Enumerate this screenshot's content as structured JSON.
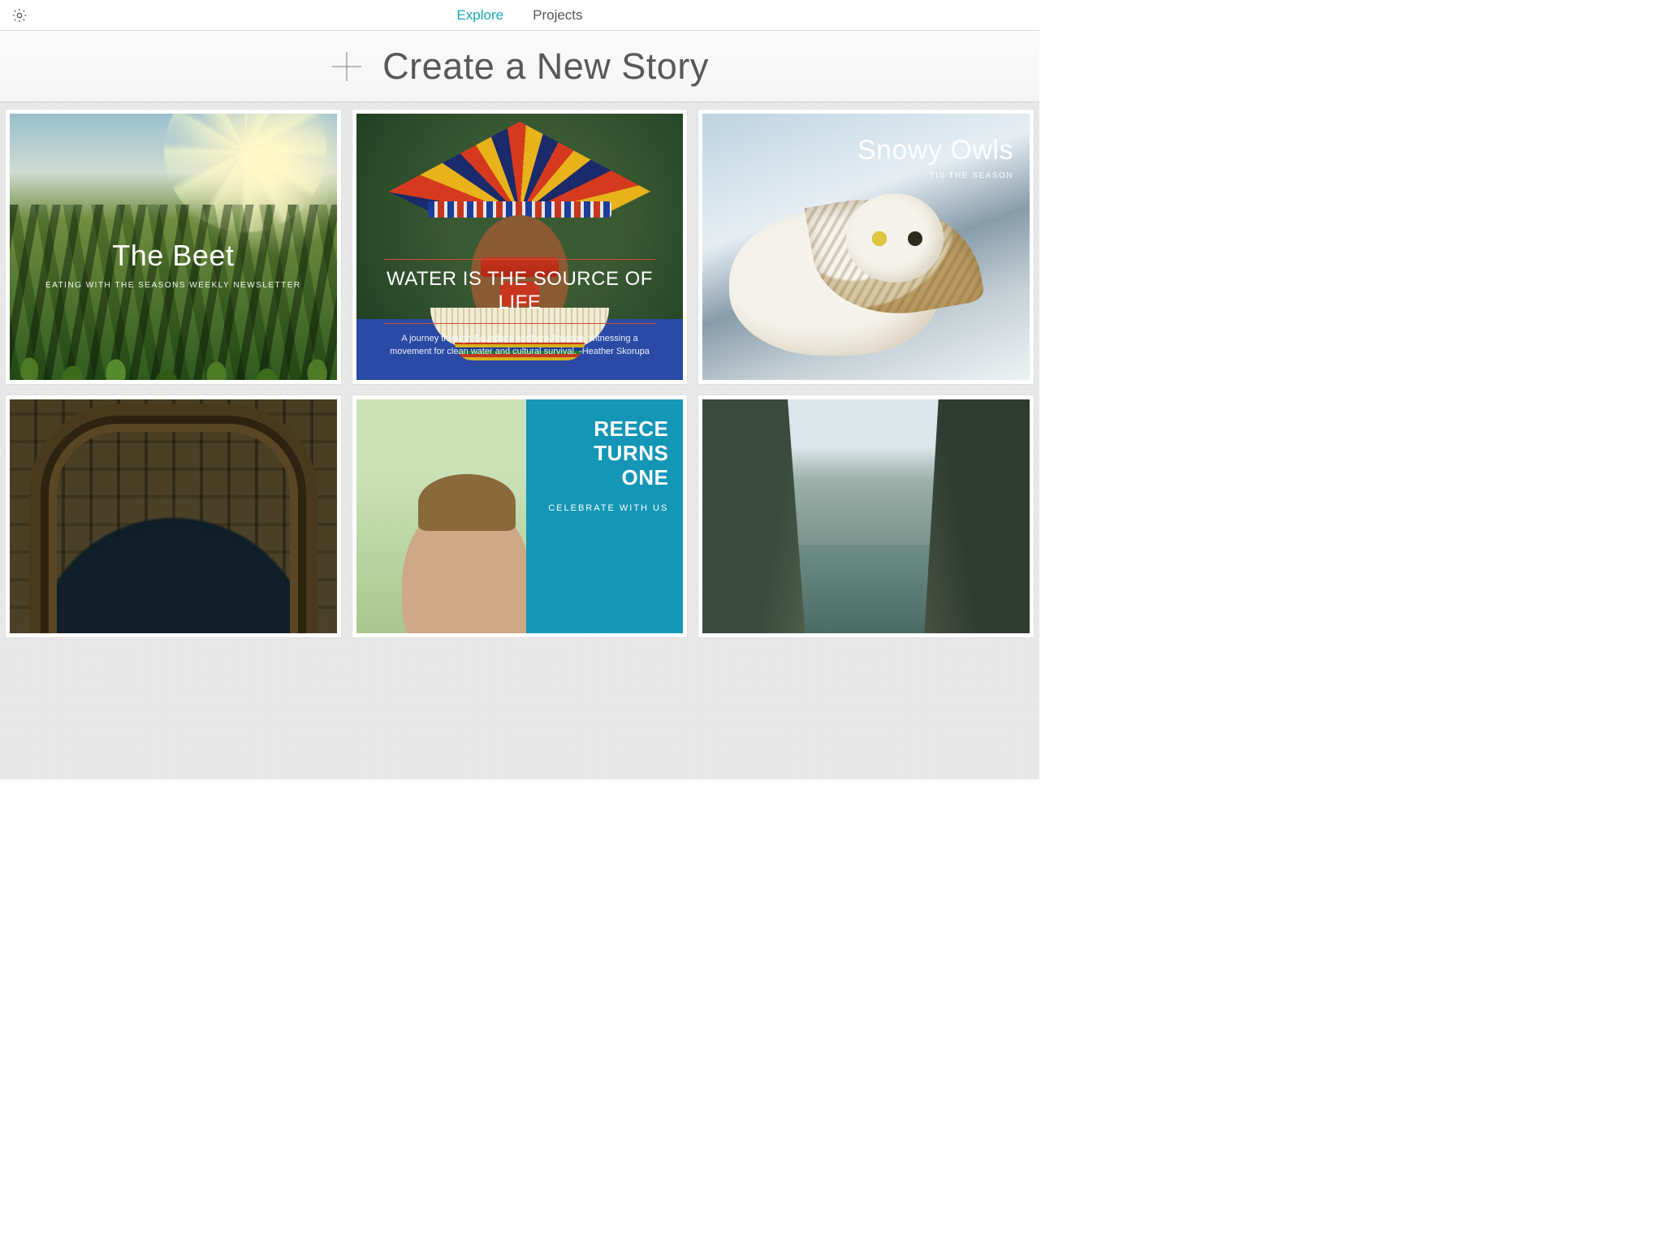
{
  "nav": {
    "tabs": [
      {
        "id": "explore",
        "label": "Explore",
        "active": true
      },
      {
        "id": "projects",
        "label": "Projects",
        "active": false
      }
    ]
  },
  "create": {
    "label": "Create a New Story"
  },
  "stories": [
    {
      "id": "the-beet",
      "title": "The Beet",
      "subtitle": "EATING WITH THE SEASONS WEEKLY NEWSLETTER"
    },
    {
      "id": "water-source",
      "title": "WATER IS THE SOURCE OF LIFE",
      "subtitle": "A journey through Ecuador's northern Amazon, witnessing a movement for clean water and cultural survival. -Heather Skorupa"
    },
    {
      "id": "snowy-owls",
      "title": "Snowy Owls",
      "subtitle": "'TIS THE SEASON"
    },
    {
      "id": "arch"
    },
    {
      "id": "reece",
      "title": "REECE TURNS ONE",
      "subtitle": "CELEBRATE WITH US"
    },
    {
      "id": "cliffs"
    }
  ],
  "colors": {
    "accent": "#1aa5b8",
    "panelBlue": "#1496b7",
    "ruleOrange": "#d34a32"
  }
}
